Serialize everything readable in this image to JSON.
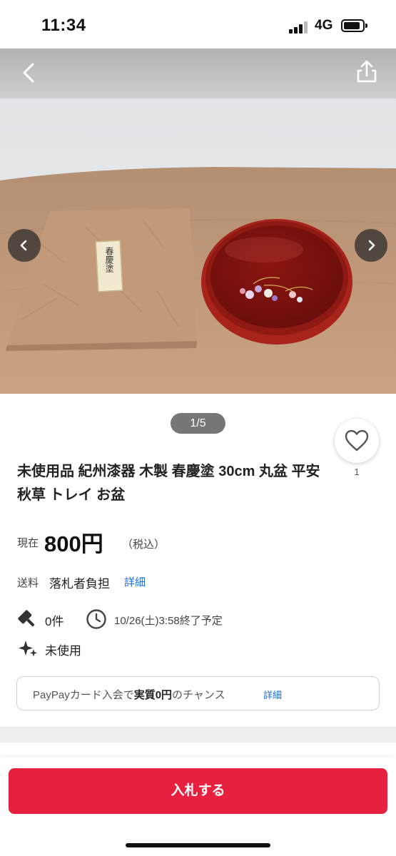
{
  "status_bar": {
    "time": "11:34",
    "network": "4G",
    "icons": [
      "signal-icon",
      "battery-icon"
    ]
  },
  "header": {
    "icons": [
      "back-icon",
      "share-icon"
    ]
  },
  "gallery": {
    "counter": "1/5",
    "icons": [
      "chevron-left-icon",
      "chevron-right-icon"
    ],
    "box_label": "春慶塗"
  },
  "favorite": {
    "count": "1",
    "icon": "heart-icon"
  },
  "item": {
    "title": "未使用品 紀州漆器 木製 春慶塗 30cm 丸盆 平安秋草 トレイ お盆",
    "price_label": "現在",
    "price": "800円",
    "tax_note": "（税込）",
    "shipping_label": "送料",
    "shipping_value": "落札者負担",
    "shipping_detail_link": "詳細",
    "bids": "0件",
    "end_time": "10/26(土)3:58終了予定",
    "condition": "未使用"
  },
  "promo": {
    "text_before": "PayPayカード入会で",
    "text_bold": "実質0円",
    "text_after": "のチャンス",
    "link": "詳細"
  },
  "bottom_bar": {
    "bid_button": "入札する"
  },
  "colors": {
    "accent": "#e8203f",
    "link": "#1a6dd6",
    "tray_red": "#9e1a14"
  }
}
